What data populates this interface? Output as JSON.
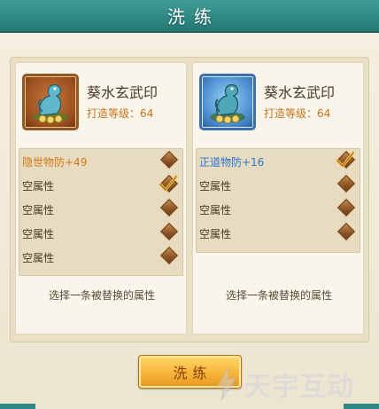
{
  "header": {
    "title": "洗练"
  },
  "cards": [
    {
      "name": "葵水玄武印",
      "level_text": "打造等级：64",
      "attrs": [
        {
          "label": "隐世物防+49",
          "color": "orange",
          "selected": false
        },
        {
          "label": "空属性",
          "color": "normal",
          "selected": true
        },
        {
          "label": "空属性",
          "color": "normal",
          "selected": false
        },
        {
          "label": "空属性",
          "color": "normal",
          "selected": false
        },
        {
          "label": "空属性",
          "color": "normal",
          "selected": false
        }
      ],
      "hint": "选择一条被替换的属性"
    },
    {
      "name": "葵水玄武印",
      "level_text": "打造等级：64",
      "attrs": [
        {
          "label": "正道物防+16",
          "color": "blue",
          "selected": true
        },
        {
          "label": "空属性",
          "color": "normal",
          "selected": false
        },
        {
          "label": "空属性",
          "color": "normal",
          "selected": false
        },
        {
          "label": "空属性",
          "color": "normal",
          "selected": false
        }
      ],
      "hint": "选择一条被替换的属性"
    }
  ],
  "action": {
    "wash_label": "洗练"
  },
  "watermark": {
    "text": "天宇互动"
  },
  "colors": {
    "accent": "#2f8883",
    "gold": "#f6b53a",
    "orange_text": "#d07914",
    "blue_text": "#2a74c9"
  }
}
